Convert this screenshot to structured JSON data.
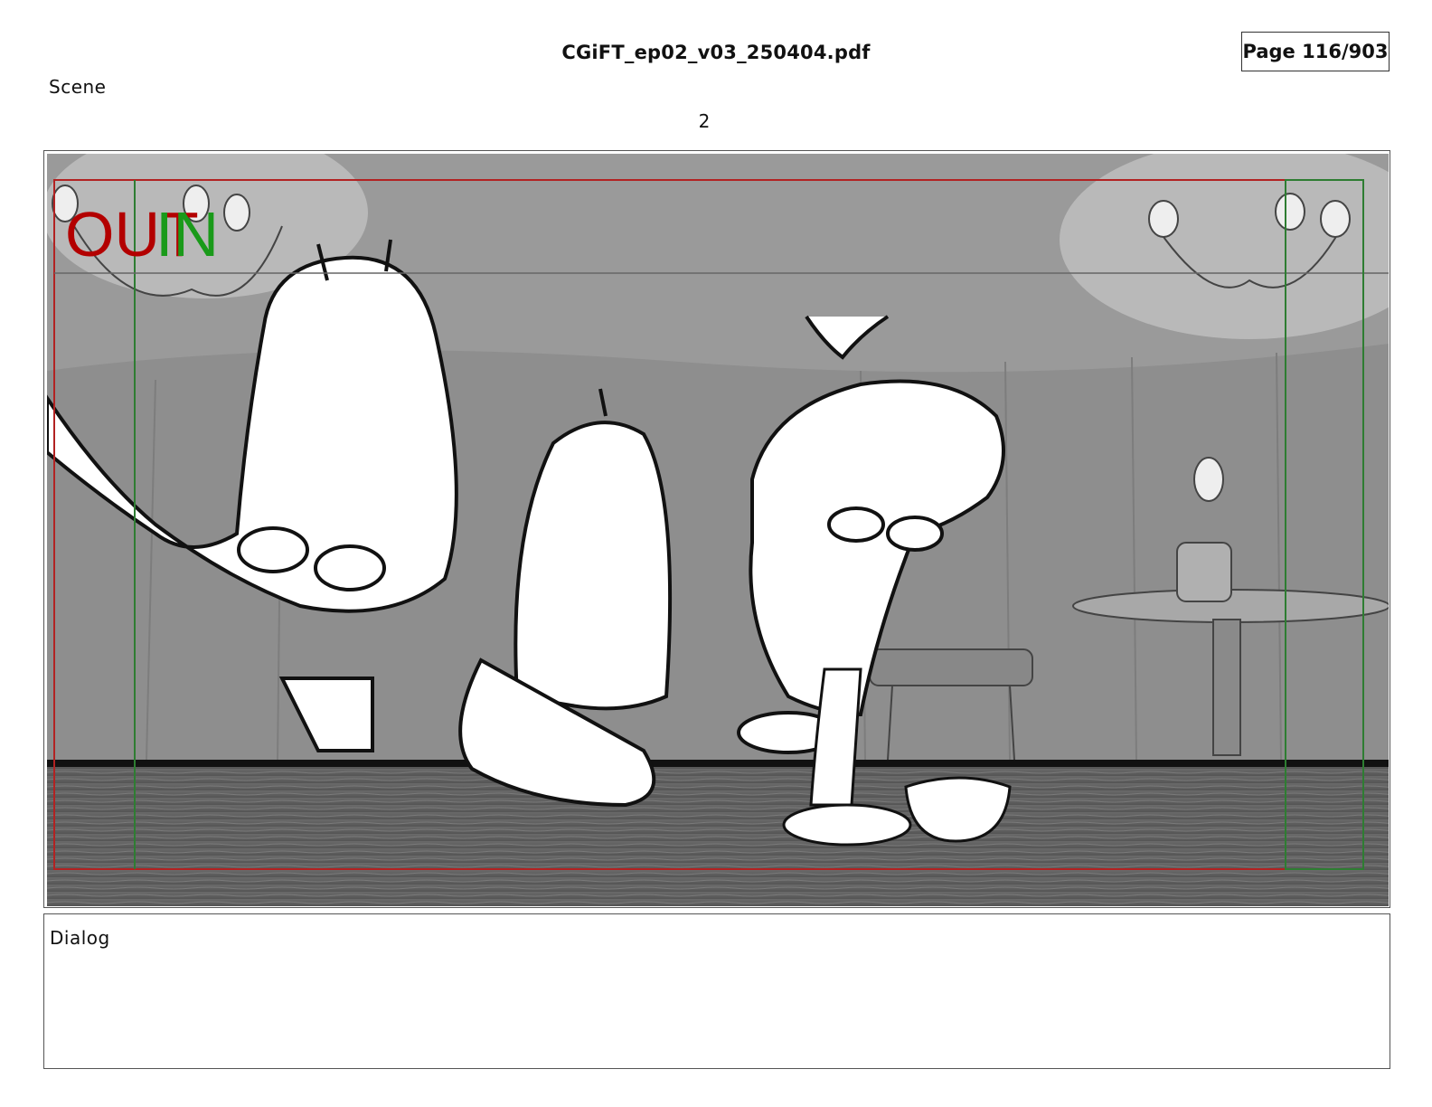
{
  "header": {
    "file_name": "CGiFT_ep02_v03_250404.pdf",
    "page_indicator": "Page 116/903"
  },
  "scene": {
    "label": "Scene",
    "number": "2"
  },
  "panel": {
    "out_tag": "OUT",
    "in_tag": "IN",
    "colors": {
      "out_tag": "#b30000",
      "in_tag": "#1a9a1a",
      "safe_frame_red": "#b22222",
      "safe_frame_green": "#2e7d32",
      "background": "#9a9a9a"
    }
  },
  "dialog": {
    "label": "Dialog"
  }
}
